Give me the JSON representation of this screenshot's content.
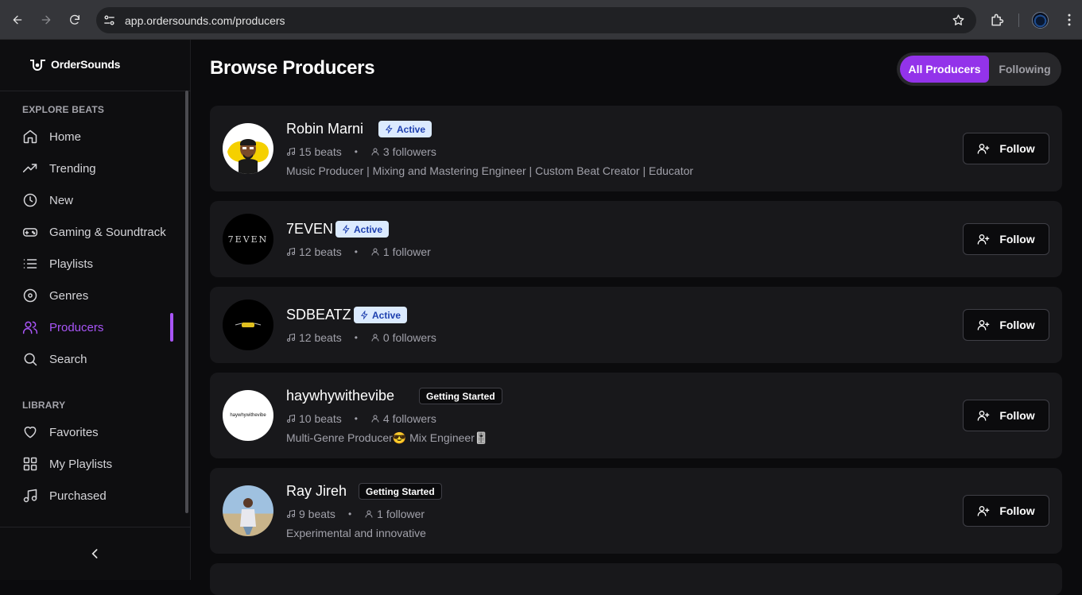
{
  "browser": {
    "url": "app.ordersounds.com/producers"
  },
  "sidebar": {
    "logo": "OrderSounds",
    "explore_title": "EXPLORE BEATS",
    "explore_items": [
      {
        "label": "Home",
        "icon": "home-icon"
      },
      {
        "label": "Trending",
        "icon": "trending-icon"
      },
      {
        "label": "New",
        "icon": "clock-icon"
      },
      {
        "label": "Gaming & Soundtrack",
        "icon": "gamepad-icon"
      },
      {
        "label": "Playlists",
        "icon": "list-icon"
      },
      {
        "label": "Genres",
        "icon": "disc-icon"
      },
      {
        "label": "Producers",
        "icon": "users-icon",
        "active": true
      },
      {
        "label": "Search",
        "icon": "search-icon"
      }
    ],
    "library_title": "LIBRARY",
    "library_items": [
      {
        "label": "Favorites",
        "icon": "heart-icon"
      },
      {
        "label": "My Playlists",
        "icon": "grid-icon"
      },
      {
        "label": "Purchased",
        "icon": "music-note-icon"
      }
    ]
  },
  "main": {
    "title": "Browse Producers",
    "toggle": {
      "all": "All Producers",
      "following": "Following",
      "selected": "All Producers"
    },
    "accent": "#9333ea",
    "producers": [
      {
        "name": "Robin Marni",
        "badge": "Active",
        "beats": "15 beats",
        "followers": "3 followers",
        "bio": "Music Producer | Mixing and Mastering Engineer | Custom Beat Creator | Educator",
        "follow": "Follow"
      },
      {
        "name": "7EVEN",
        "badge": "Active",
        "beats": "12 beats",
        "followers": "1 follower",
        "bio": "",
        "follow": "Follow",
        "avatar_text": "7EVEN"
      },
      {
        "name": "SDBEATZ",
        "badge": "Active",
        "beats": "12 beats",
        "followers": "0 followers",
        "bio": "",
        "follow": "Follow"
      },
      {
        "name": "haywhywithevibe",
        "badge": "Getting Started",
        "beats": "10 beats",
        "followers": "4 followers",
        "bio": "Multi-Genre Producer😎 Mix Engineer🎚️",
        "follow": "Follow",
        "avatar_text": "haywhywithevibe"
      },
      {
        "name": "Ray Jireh",
        "badge": "Getting Started",
        "beats": "9 beats",
        "followers": "1 follower",
        "bio": "Experimental and innovative",
        "follow": "Follow"
      }
    ]
  }
}
